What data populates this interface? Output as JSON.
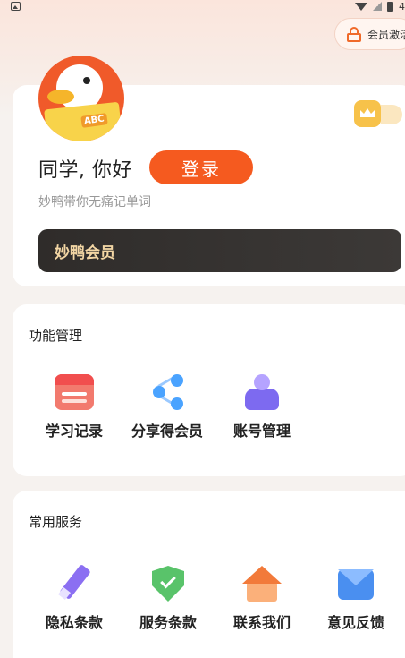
{
  "header": {
    "status_time_fragment": "4",
    "vip_activate_label": "会员激活"
  },
  "profile": {
    "avatar_badge": "ABC",
    "greeting": "同学, 你好",
    "login_label": "登录",
    "subtitle": "妙鸭带你无痛记单词",
    "vip_banner_label": "妙鸭会员"
  },
  "functions": {
    "title": "功能管理",
    "items": [
      {
        "label": "学习记录",
        "icon": "calendar-icon"
      },
      {
        "label": "分享得会员",
        "icon": "share-icon"
      },
      {
        "label": "账号管理",
        "icon": "account-icon"
      }
    ]
  },
  "services": {
    "title": "常用服务",
    "items": [
      {
        "label": "隐私条款",
        "icon": "pen-icon"
      },
      {
        "label": "服务条款",
        "icon": "shield-check-icon"
      },
      {
        "label": "联系我们",
        "icon": "house-icon"
      },
      {
        "label": "意见反馈",
        "icon": "mail-icon"
      }
    ]
  },
  "colors": {
    "accent": "#f55a1f",
    "vip_banner_bg": "#2f2c2a",
    "vip_banner_text": "#f3d6a4"
  }
}
